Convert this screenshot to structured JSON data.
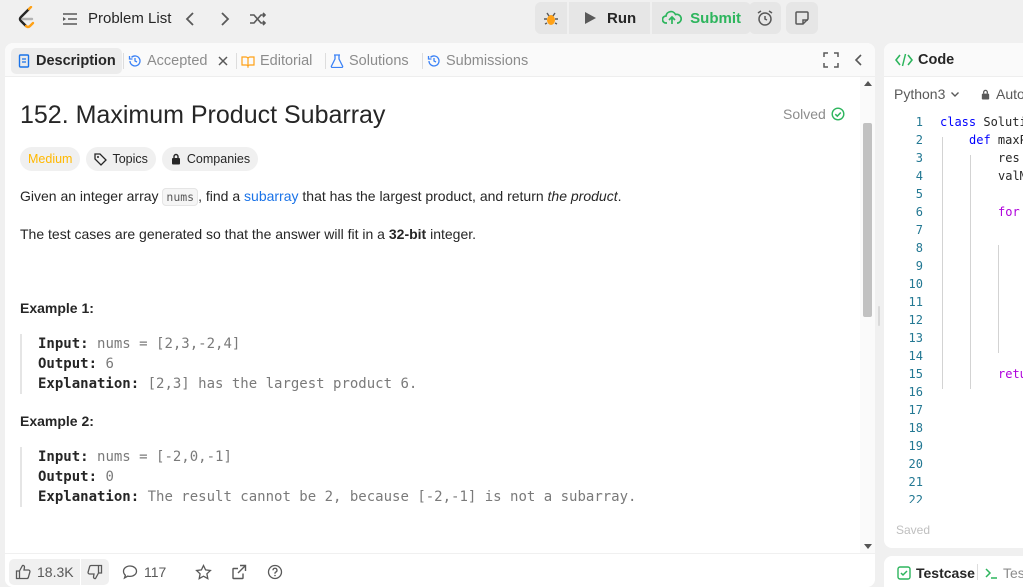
{
  "header": {
    "problem_list_label": "Problem List",
    "run_label": "Run",
    "submit_label": "Submit"
  },
  "tabs": [
    {
      "label": "Description",
      "active": true
    },
    {
      "label": "Accepted",
      "active": false
    },
    {
      "label": "Editorial",
      "active": false
    },
    {
      "label": "Solutions",
      "active": false
    },
    {
      "label": "Submissions",
      "active": false
    }
  ],
  "problem": {
    "title": "152. Maximum Product Subarray",
    "status": "Solved",
    "difficulty": "Medium",
    "topics_label": "Topics",
    "companies_label": "Companies",
    "desc1_pre": "Given an integer array ",
    "desc1_code": "nums",
    "desc1_mid": ", find a ",
    "desc1_link": "subarray",
    "desc1_post": " that has the largest product, and return ",
    "desc1_em": "the product",
    "desc1_end": ".",
    "desc2_pre": "The test cases are generated so that the answer will fit in a ",
    "desc2_bold": "32-bit",
    "desc2_post": " integer.",
    "examples": [
      {
        "heading": "Example 1:",
        "input_label": "Input:",
        "input": "nums = [2,3,-2,4]",
        "output_label": "Output:",
        "output": "6",
        "explanation_label": "Explanation:",
        "explanation": "[2,3] has the largest product 6."
      },
      {
        "heading": "Example 2:",
        "input_label": "Input:",
        "input": "nums = [-2,0,-1]",
        "output_label": "Output:",
        "output": "0",
        "explanation_label": "Explanation:",
        "explanation": "The result cannot be 2, because [-2,-1] is not a subarray."
      }
    ]
  },
  "footer": {
    "likes": "18.3K",
    "comments": "117"
  },
  "code_panel": {
    "title": "Code",
    "language": "Python3",
    "auto_label": "Auto",
    "saved_label": "Saved",
    "line_numbers": [
      "1",
      "2",
      "3",
      "4",
      "5",
      "6",
      "7",
      "8",
      "9",
      "10",
      "11",
      "12",
      "13",
      "14",
      "15",
      "16",
      "17",
      "18",
      "19",
      "20",
      "21",
      "22"
    ],
    "lines": [
      {
        "kw": "class",
        "rest": " Soluti"
      },
      {
        "kw": "def",
        "rest": " maxP"
      },
      {
        "kw": "",
        "rest": "res"
      },
      {
        "kw": "",
        "rest": "valM"
      },
      {
        "kw": "",
        "rest": ""
      },
      {
        "kw2": "for",
        "rest": ""
      },
      {
        "kw": "",
        "rest": ""
      },
      {
        "kw": "",
        "rest": ""
      },
      {
        "kw": "",
        "rest": ""
      },
      {
        "kw": "",
        "rest": ""
      },
      {
        "kw": "",
        "rest": ""
      },
      {
        "kw": "",
        "rest": ""
      },
      {
        "kw": "",
        "rest": ""
      },
      {
        "kw": "",
        "rest": ""
      },
      {
        "kw2": "retu",
        "rest": ""
      }
    ]
  },
  "testcase_panel": {
    "testcase_label": "Testcase",
    "test_result_label": "Tes"
  },
  "colors": {
    "accent_green": "#2db55d",
    "medium": "#ffb800",
    "link": "#1a73e8"
  }
}
